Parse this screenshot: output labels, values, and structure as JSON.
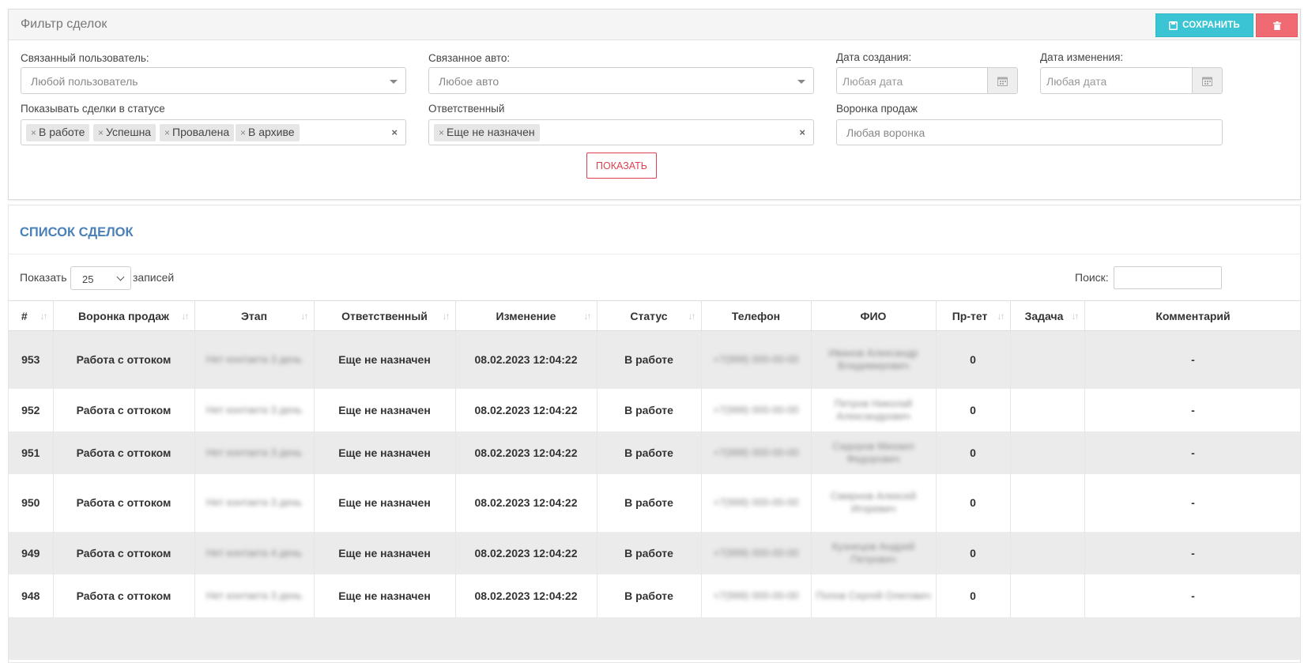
{
  "filter": {
    "title": "Фильтр сделок",
    "save_label": "СОХРАНИТЬ",
    "linked_user": {
      "label": "Связанный пользователь:",
      "placeholder": "Любой пользователь"
    },
    "linked_car": {
      "label": "Связанное авто:",
      "placeholder": "Любое авто"
    },
    "created_date": {
      "label": "Дата создания:",
      "placeholder": "Любая дата"
    },
    "changed_date": {
      "label": "Дата изменения:",
      "placeholder": "Любая дата"
    },
    "status": {
      "label": "Показывать сделки в статусе",
      "tags": [
        "В работе",
        "Успешна",
        "Провалена",
        "В архиве"
      ]
    },
    "responsible": {
      "label": "Ответственный",
      "tags": [
        "Еще не назначен"
      ]
    },
    "funnel": {
      "label": "Воронка продаж",
      "placeholder": "Любая воронка"
    },
    "show_label": "ПОКАЗАТЬ"
  },
  "list": {
    "title": "СПИСОК СДЕЛОК",
    "length_before": "Показать",
    "length_value": "25",
    "length_after": "записей",
    "search_label": "Поиск:",
    "columns": [
      "#",
      "Воронка продаж",
      "Этап",
      "Ответственный",
      "Изменение",
      "Статус",
      "Телефон",
      "ФИО",
      "Пр-тет",
      "Задача",
      "Комментарий"
    ],
    "rows": [
      {
        "id": "953",
        "funnel": "Работа с оттоком",
        "stage": "Нет контакта 3 день",
        "responsible": "Еще не назначен",
        "changed": "08.02.2023 12:04:22",
        "status": "В работе",
        "phone": "+7(999) 000-00-00",
        "fio": "Иванов Александр Владимирович",
        "priority": "0",
        "task": "",
        "comment": "-"
      },
      {
        "id": "952",
        "funnel": "Работа с оттоком",
        "stage": "Нет контакта 3 день",
        "responsible": "Еще не назначен",
        "changed": "08.02.2023 12:04:22",
        "status": "В работе",
        "phone": "+7(999) 000-00-00",
        "fio": "Петров Николай Александрович",
        "priority": "0",
        "task": "",
        "comment": "-"
      },
      {
        "id": "951",
        "funnel": "Работа с оттоком",
        "stage": "Нет контакта 3 день",
        "responsible": "Еще не назначен",
        "changed": "08.02.2023 12:04:22",
        "status": "В работе",
        "phone": "+7(999) 000-00-00",
        "fio": "Сидоров Михаил Федорович",
        "priority": "0",
        "task": "",
        "comment": "-"
      },
      {
        "id": "950",
        "funnel": "Работа с оттоком",
        "stage": "Нет контакта 3 день",
        "responsible": "Еще не назначен",
        "changed": "08.02.2023 12:04:22",
        "status": "В работе",
        "phone": "+7(999) 000-00-00",
        "fio": "Смирнов Алексей Игоревич",
        "priority": "0",
        "task": "",
        "comment": "-"
      },
      {
        "id": "949",
        "funnel": "Работа с оттоком",
        "stage": "Нет контакта 4 день",
        "responsible": "Еще не назначен",
        "changed": "08.02.2023 12:04:22",
        "status": "В работе",
        "phone": "+7(999) 000-00-00",
        "fio": "Кузнецов Андрей Петрович",
        "priority": "0",
        "task": "",
        "comment": "-"
      },
      {
        "id": "948",
        "funnel": "Работа с оттоком",
        "stage": "Нет контакта 3 день",
        "responsible": "Еще не назначен",
        "changed": "08.02.2023 12:04:22",
        "status": "В работе",
        "phone": "+7(999) 000-00-00",
        "fio": "Попов Сергей Олегович",
        "priority": "0",
        "task": "",
        "comment": "-"
      }
    ]
  }
}
